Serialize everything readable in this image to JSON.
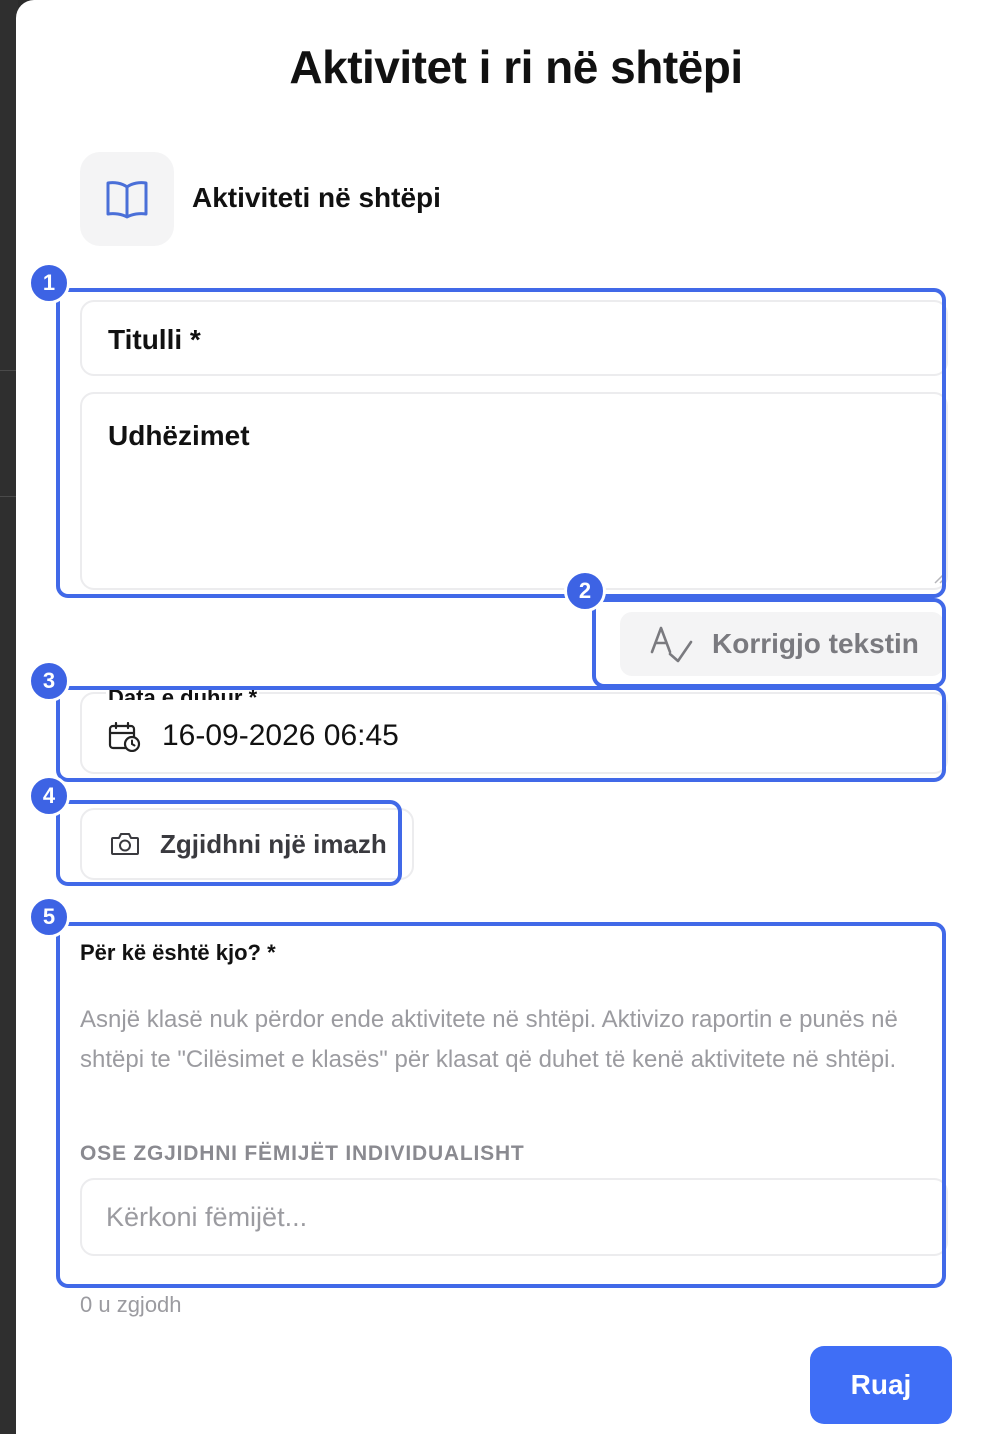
{
  "dialog": {
    "title": "Aktivitet i ri në shtëpi",
    "type": {
      "icon": "open-book-icon",
      "label": "Aktiviteti në shtëpi"
    }
  },
  "form": {
    "title_label": "Titulli *",
    "instructions_label": "Udhëzimet",
    "correct_text_button": {
      "icon": "spellcheck-icon",
      "label": "Korrigjo tekstin"
    },
    "due_date": {
      "label": "Data e duhur *",
      "icon": "calendar-clock-icon",
      "value": "16-09-2026 06:45"
    },
    "image_button": {
      "icon": "camera-icon",
      "label": "Zgjidhni një imazh"
    },
    "recipients": {
      "label": "Për kë është kjo? *",
      "hint": "Asnjë klasë nuk përdor ende aktivitete në shtëpi. Aktivizo raportin e punës në shtëpi te \"Cilësimet e klasës\" për klasat që duhet të kenë aktivitete në shtëpi.",
      "or_caption": "OSE ZGJIDHNI FËMIJËT INDIVIDUALISHT",
      "search_placeholder": "Kërkoni fëmijët...",
      "selected_count": "0 u zgjodh"
    },
    "save_label": "Ruaj"
  },
  "annotations": [
    "1",
    "2",
    "3",
    "4",
    "5"
  ],
  "colors": {
    "accent": "#3f6ef6",
    "annotation": "#4169e8",
    "muted_text": "#9b9ba0",
    "field_border": "#ececee"
  }
}
